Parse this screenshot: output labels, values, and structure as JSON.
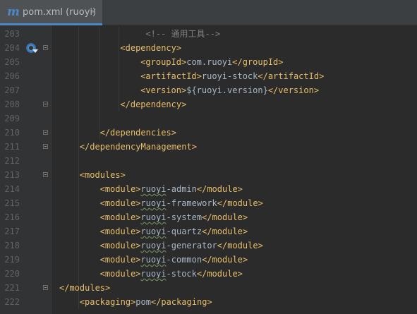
{
  "tab": {
    "icon": "m",
    "title": "pom.xml (ruoyi)",
    "close": "×"
  },
  "lines": [
    {
      "num": "203",
      "fold": false,
      "gutter_icon": false,
      "indent": 17,
      "parts": [
        {
          "t": "<!-- 通用工具-->",
          "c": "comment"
        }
      ]
    },
    {
      "num": "204",
      "fold": true,
      "gutter_icon": true,
      "indent": 12,
      "parts": [
        {
          "t": "<dependency>",
          "c": "tag"
        }
      ]
    },
    {
      "num": "205",
      "fold": false,
      "gutter_icon": false,
      "indent": 16,
      "parts": [
        {
          "t": "<groupId>",
          "c": "tag"
        },
        {
          "t": "com.ruoyi",
          "c": "text"
        },
        {
          "t": "</groupId>",
          "c": "tag"
        }
      ]
    },
    {
      "num": "206",
      "fold": false,
      "gutter_icon": false,
      "indent": 16,
      "parts": [
        {
          "t": "<artifactId>",
          "c": "tag"
        },
        {
          "t": "ruoyi-stock",
          "c": "text"
        },
        {
          "t": "</artifactId>",
          "c": "tag"
        }
      ]
    },
    {
      "num": "207",
      "fold": false,
      "gutter_icon": false,
      "indent": 16,
      "parts": [
        {
          "t": "<version>",
          "c": "tag"
        },
        {
          "t": "${ruoyi.version}",
          "c": "text"
        },
        {
          "t": "</version>",
          "c": "tag"
        }
      ]
    },
    {
      "num": "208",
      "fold": true,
      "gutter_icon": false,
      "indent": 12,
      "parts": [
        {
          "t": "</dependency>",
          "c": "tag"
        }
      ]
    },
    {
      "num": "209",
      "fold": false,
      "gutter_icon": false,
      "indent": 0,
      "parts": []
    },
    {
      "num": "210",
      "fold": true,
      "gutter_icon": false,
      "indent": 8,
      "parts": [
        {
          "t": "</dependencies>",
          "c": "tag"
        }
      ]
    },
    {
      "num": "211",
      "fold": true,
      "gutter_icon": false,
      "indent": 4,
      "parts": [
        {
          "t": "</dependencyManagement>",
          "c": "tag"
        }
      ]
    },
    {
      "num": "212",
      "fold": false,
      "gutter_icon": false,
      "indent": 0,
      "parts": []
    },
    {
      "num": "213",
      "fold": true,
      "gutter_icon": false,
      "indent": 4,
      "parts": [
        {
          "t": "<modules>",
          "c": "tag"
        }
      ]
    },
    {
      "num": "214",
      "fold": false,
      "gutter_icon": false,
      "indent": 8,
      "parts": [
        {
          "t": "<module>",
          "c": "tag"
        },
        {
          "t": "ruoyi",
          "c": "wavy"
        },
        {
          "t": "-admin",
          "c": "text"
        },
        {
          "t": "</module>",
          "c": "tag"
        }
      ]
    },
    {
      "num": "215",
      "fold": false,
      "gutter_icon": false,
      "indent": 8,
      "parts": [
        {
          "t": "<module>",
          "c": "tag"
        },
        {
          "t": "ruoyi",
          "c": "wavy"
        },
        {
          "t": "-framework",
          "c": "text"
        },
        {
          "t": "</module>",
          "c": "tag"
        }
      ]
    },
    {
      "num": "216",
      "fold": false,
      "gutter_icon": false,
      "indent": 8,
      "parts": [
        {
          "t": "<module>",
          "c": "tag"
        },
        {
          "t": "ruoyi",
          "c": "wavy"
        },
        {
          "t": "-system",
          "c": "text"
        },
        {
          "t": "</module>",
          "c": "tag"
        }
      ]
    },
    {
      "num": "217",
      "fold": false,
      "gutter_icon": false,
      "indent": 8,
      "parts": [
        {
          "t": "<module>",
          "c": "tag"
        },
        {
          "t": "ruoyi",
          "c": "wavy"
        },
        {
          "t": "-quartz",
          "c": "text"
        },
        {
          "t": "</module>",
          "c": "tag"
        }
      ]
    },
    {
      "num": "218",
      "fold": false,
      "gutter_icon": false,
      "indent": 8,
      "parts": [
        {
          "t": "<module>",
          "c": "tag"
        },
        {
          "t": "ruoyi",
          "c": "wavy"
        },
        {
          "t": "-generator",
          "c": "text"
        },
        {
          "t": "</module>",
          "c": "tag"
        }
      ]
    },
    {
      "num": "219",
      "fold": false,
      "gutter_icon": false,
      "indent": 8,
      "parts": [
        {
          "t": "<module>",
          "c": "tag"
        },
        {
          "t": "ruoyi",
          "c": "wavy"
        },
        {
          "t": "-common",
          "c": "text"
        },
        {
          "t": "</module>",
          "c": "tag"
        }
      ]
    },
    {
      "num": "220",
      "fold": false,
      "gutter_icon": false,
      "indent": 8,
      "parts": [
        {
          "t": "<module>",
          "c": "tag"
        },
        {
          "t": "ruoyi",
          "c": "wavy"
        },
        {
          "t": "-stock",
          "c": "text"
        },
        {
          "t": "</module>",
          "c": "tag"
        }
      ]
    },
    {
      "num": "221",
      "fold": true,
      "gutter_icon": false,
      "indent": 0,
      "parts": [
        {
          "t": "</modules>",
          "c": "tag"
        }
      ]
    },
    {
      "num": "222",
      "fold": false,
      "gutter_icon": false,
      "indent": 4,
      "parts": [
        {
          "t": "<packaging>",
          "c": "tag"
        },
        {
          "t": "pom",
          "c": "text"
        },
        {
          "t": "</packaging>",
          "c": "tag"
        }
      ]
    }
  ],
  "colors": {
    "background": "#2b2b2b",
    "gutter": "#313335",
    "tag": "#e8bf6a",
    "text": "#a9b7c6",
    "comment": "#808080",
    "line_number": "#606366",
    "accent": "#4a88c7"
  }
}
